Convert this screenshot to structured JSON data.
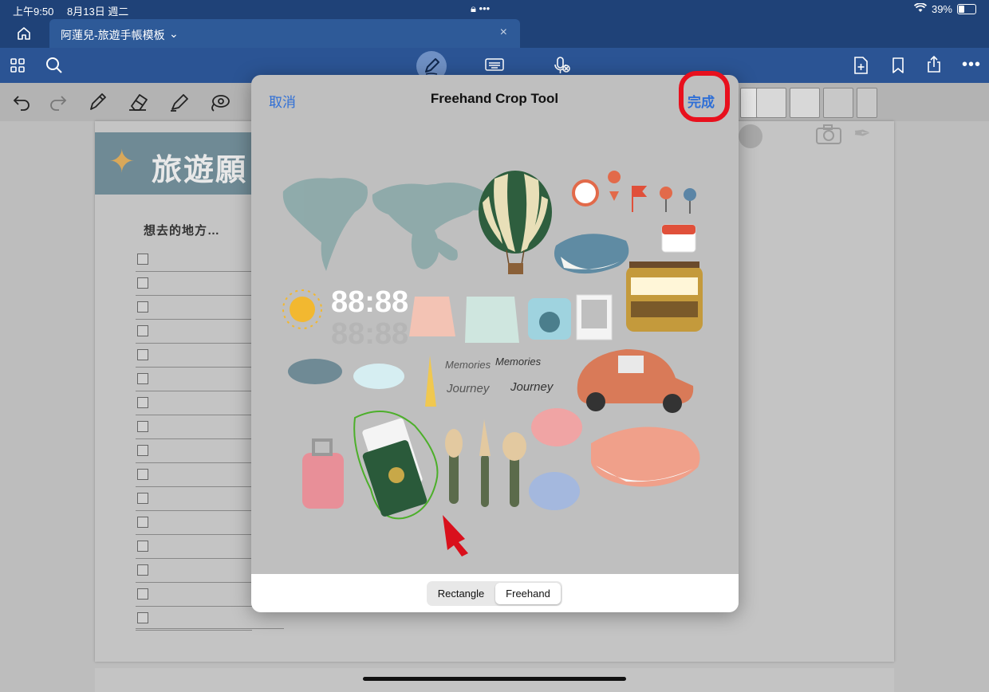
{
  "status": {
    "time": "上午9:50",
    "date": "8月13日 週二",
    "battery": "39%",
    "battery_level": 0.39
  },
  "tab": {
    "title": "阿蓮兒-旅遊手帳模板",
    "chevron": "⌄",
    "close": "×"
  },
  "page": {
    "title": "旅遊願",
    "list_heading": "想去的地方…",
    "checkbox_count": 16
  },
  "modal": {
    "cancel": "取消",
    "title": "Freehand Crop Tool",
    "done": "完成",
    "segments": [
      "Rectangle",
      "Freehand"
    ],
    "selected_segment": "Freehand",
    "clock_digits": "88:88",
    "script_words": [
      "Memories",
      "Memories",
      "Journey",
      "Journey"
    ]
  },
  "colors": {
    "accent": "#2f6fd6",
    "highlight_ring": "#e8101d",
    "toolbar": "#2b5494",
    "lasso": "#4caf2a",
    "arrow": "#d9101c"
  },
  "icons": [
    "home-icon",
    "grid-icon",
    "search-icon",
    "pencil-icon",
    "keyboard-icon",
    "mic-icon",
    "add-page-icon",
    "bookmark-icon",
    "share-icon",
    "more-icon",
    "undo-icon",
    "redo-icon",
    "pen-icon",
    "eraser-icon",
    "highlighter-icon",
    "lasso-icon"
  ]
}
